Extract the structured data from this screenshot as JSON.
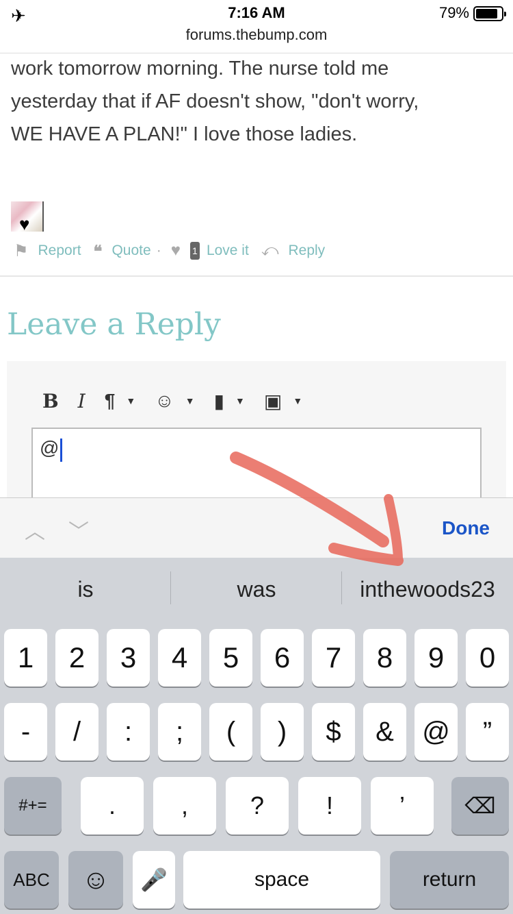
{
  "status_bar": {
    "time": "7:16 AM",
    "battery_percent": "79%",
    "battery_level": 0.79,
    "url": "forums.thebump.com"
  },
  "post": {
    "lines": [
      "work tomorrow morning. The nurse told me",
      "yesterday that if AF doesn't show, \"don't worry,",
      "WE HAVE A PLAN!\" I love those ladies."
    ],
    "actions": {
      "report": "Report",
      "quote": "Quote",
      "separator": "·",
      "love_count": "1",
      "love": "Love it",
      "reply": "Reply"
    }
  },
  "reply_section": {
    "title": "Leave a Reply",
    "toolbar": {
      "bold": "B",
      "italic": "I",
      "paragraph": "¶",
      "emoji": "☺",
      "document": "▮",
      "image": "▣"
    },
    "textarea_value": "@"
  },
  "accessory": {
    "prev": "︿",
    "next": "﹀",
    "done": "Done"
  },
  "keyboard": {
    "suggestions": [
      "is",
      "was",
      "inthewoods23"
    ],
    "row1": [
      "1",
      "2",
      "3",
      "4",
      "5",
      "6",
      "7",
      "8",
      "9",
      "0"
    ],
    "row2": [
      "-",
      "/",
      ":",
      ";",
      "(",
      ")",
      "$",
      "&",
      "@",
      "”"
    ],
    "row3": {
      "shift": "#+=",
      "keys": [
        ".",
        ",",
        "?",
        "!",
        "’"
      ],
      "backspace": "⌫"
    },
    "row4": {
      "abc": "ABC",
      "emoji": "☺",
      "mic": "🎤",
      "space": "space",
      "return": "return"
    }
  },
  "annotation": {
    "arrow_color": "#e8675a",
    "target": "inthewoods23"
  },
  "colors": {
    "accent_teal": "#83c7c7",
    "done_blue": "#1b55c7",
    "keyboard_bg": "#d1d4d9"
  }
}
